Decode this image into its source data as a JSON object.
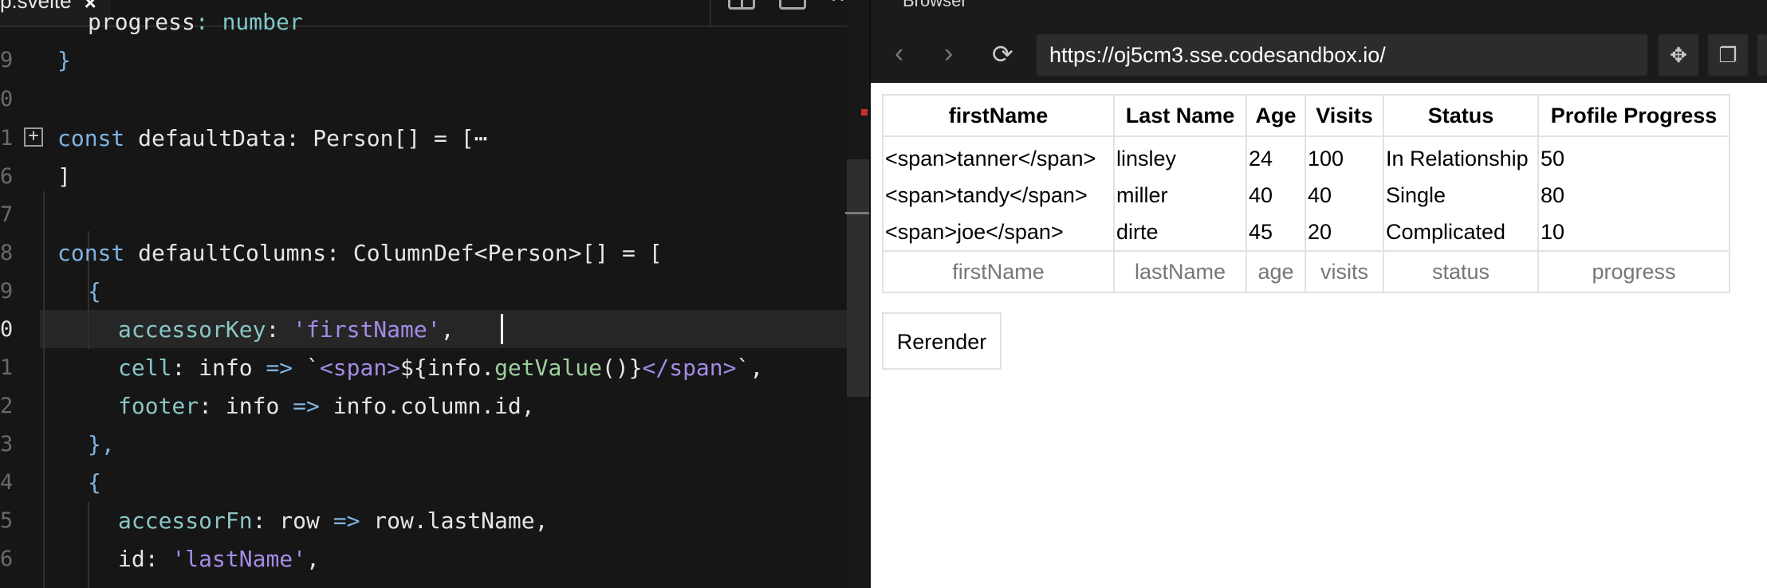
{
  "editor": {
    "tab": {
      "filename": "p.svelte",
      "close": "×"
    },
    "line_numbers": [
      "9",
      "0",
      "1",
      "6",
      "7",
      "8",
      "9",
      "0",
      "1",
      "2",
      "3",
      "4",
      "5",
      "6"
    ],
    "active_line_number": "0",
    "code": {
      "l0_key": "progress",
      "l0_rest": ": number",
      "l1": "}",
      "l2_kw": "const",
      "l2_rest": " defaultData: Person[] = [",
      "l2_ellipsis": "⋯",
      "l3": "]",
      "l4_kw": "const",
      "l4_rest": " defaultColumns: ColumnDef<Person>[] = [",
      "l5": "{",
      "l6_key": "accessorKey",
      "l6_colon": ": ",
      "l6_str": "'firstName'",
      "l6_end": ",",
      "l7_key": "cell",
      "l7_a": ": info ",
      "l7_arrow": "=>",
      "l7_b": " `",
      "l7_tag1": "<span>",
      "l7_expr": "${info.",
      "l7_fn": "getValue",
      "l7_c": "()}",
      "l7_tag2": "</span>",
      "l7_end": "`,",
      "l8_key": "footer",
      "l8_a": ": info ",
      "l8_arrow": "=>",
      "l8_b": " info.column.id,",
      "l9": "},",
      "l10": "{",
      "l11_key": "accessorFn",
      "l11_a": ": row ",
      "l11_arrow": "=>",
      "l11_b": " row.lastName,",
      "l12_key": "id",
      "l12_colon": ": ",
      "l12_str": "'lastName'",
      "l12_end": ","
    }
  },
  "browser": {
    "title": "Browser",
    "url": "https://oj5cm3.sse.codesandbox.io/",
    "back": "‹",
    "forward": "›",
    "reload": "⟳",
    "table": {
      "headers": [
        "firstName",
        "Last Name",
        "Age",
        "Visits",
        "Status",
        "Profile Progress"
      ],
      "rows": [
        [
          "<span>tanner</span>",
          "linsley",
          "24",
          "100",
          "In Relationship",
          "50"
        ],
        [
          "<span>tandy</span>",
          "miller",
          "40",
          "40",
          "Single",
          "80"
        ],
        [
          "<span>joe</span>",
          "dirte",
          "45",
          "20",
          "Complicated",
          "10"
        ]
      ],
      "footers": [
        "firstName",
        "lastName",
        "age",
        "visits",
        "status",
        "progress"
      ]
    },
    "rerender_label": "Rerender"
  }
}
